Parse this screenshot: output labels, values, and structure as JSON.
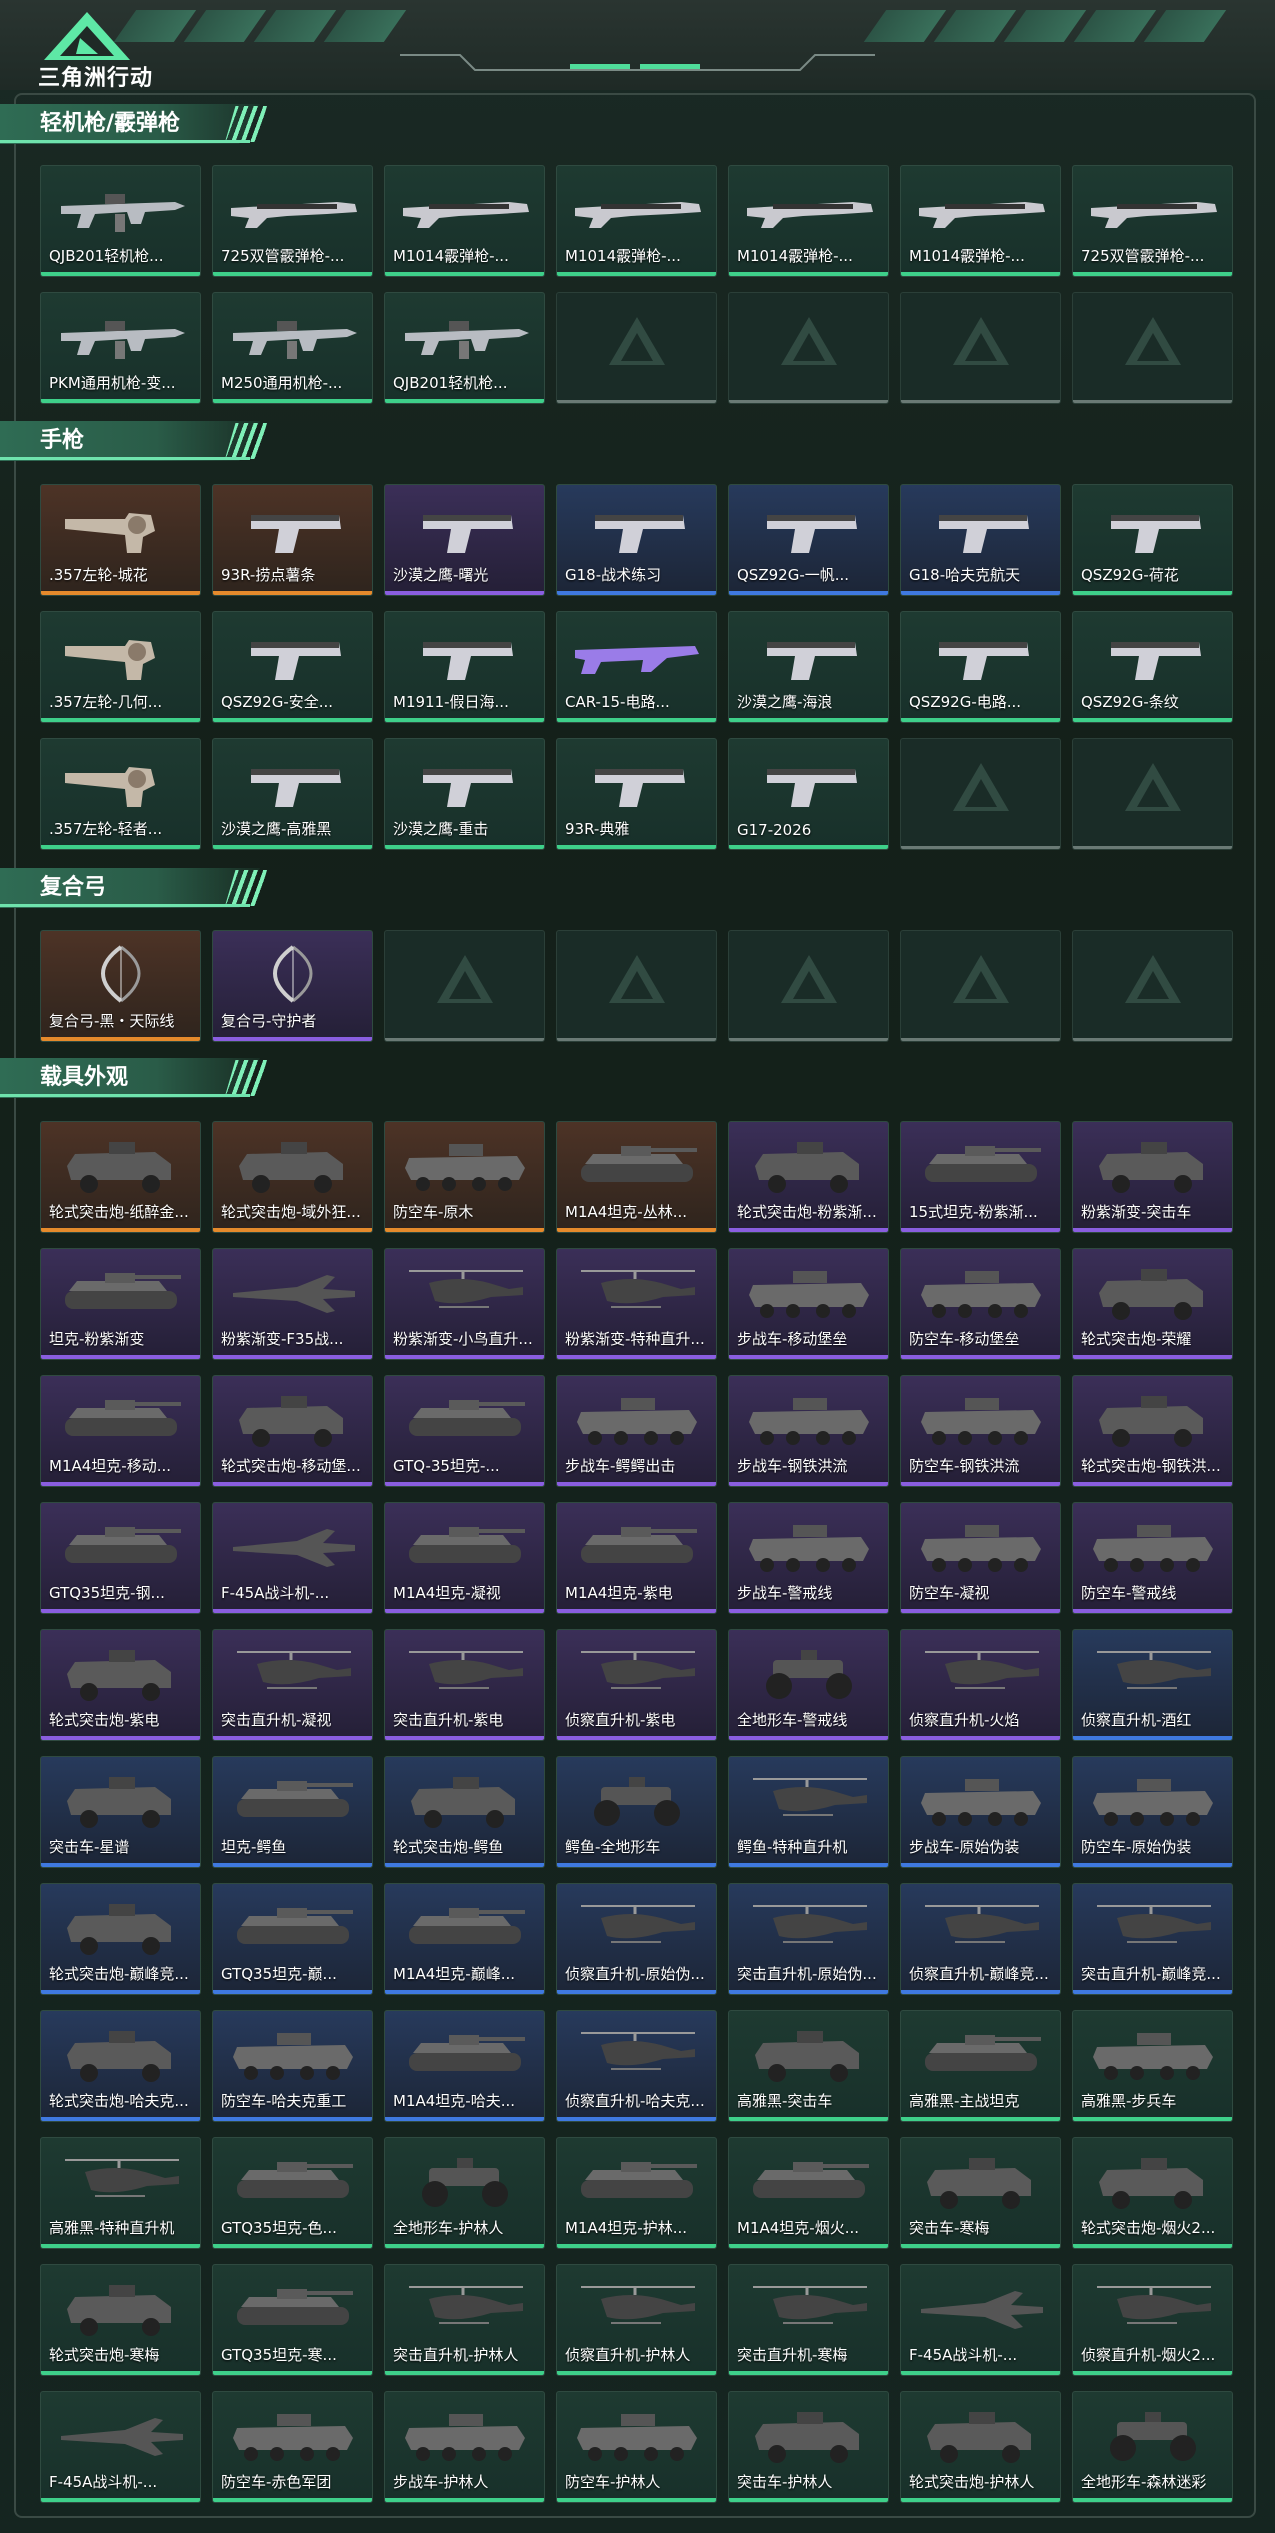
{
  "header": {
    "logo_text": "三角洲行动"
  },
  "sections": [
    {
      "title": "轻机枪/霰弹枪",
      "items": [
        {
          "label": "QJB201轻机枪...",
          "rarity": "green",
          "icon": "machine-gun"
        },
        {
          "label": "725双管霰弹枪-...",
          "rarity": "green",
          "icon": "shotgun"
        },
        {
          "label": "M1014霰弹枪-...",
          "rarity": "green",
          "icon": "shotgun"
        },
        {
          "label": "M1014霰弹枪-...",
          "rarity": "green",
          "icon": "shotgun"
        },
        {
          "label": "M1014霰弹枪-...",
          "rarity": "green",
          "icon": "shotgun"
        },
        {
          "label": "M1014霰弹枪-...",
          "rarity": "green",
          "icon": "shotgun"
        },
        {
          "label": "725双管霰弹枪-...",
          "rarity": "green",
          "icon": "shotgun"
        },
        {
          "label": "PKM通用机枪-变...",
          "rarity": "green",
          "icon": "machine-gun"
        },
        {
          "label": "M250通用机枪-...",
          "rarity": "green",
          "icon": "machine-gun"
        },
        {
          "label": "QJB201轻机枪...",
          "rarity": "green",
          "icon": "machine-gun"
        },
        {
          "label": "",
          "rarity": "empty",
          "icon": "empty-slot"
        },
        {
          "label": "",
          "rarity": "empty",
          "icon": "empty-slot"
        },
        {
          "label": "",
          "rarity": "empty",
          "icon": "empty-slot"
        },
        {
          "label": "",
          "rarity": "empty",
          "icon": "empty-slot"
        }
      ]
    },
    {
      "title": "手枪",
      "items": [
        {
          "label": ".357左轮-城花",
          "rarity": "orange",
          "icon": "revolver"
        },
        {
          "label": "93R-捞点薯条",
          "rarity": "orange",
          "icon": "pistol"
        },
        {
          "label": "沙漠之鹰-曙光",
          "rarity": "purple",
          "icon": "pistol"
        },
        {
          "label": "G18-战术练习",
          "rarity": "blue",
          "icon": "pistol"
        },
        {
          "label": "QSZ92G-一帆...",
          "rarity": "blue",
          "icon": "pistol"
        },
        {
          "label": "G18-哈夫克航天",
          "rarity": "blue",
          "icon": "pistol"
        },
        {
          "label": "QSZ92G-荷花",
          "rarity": "green",
          "icon": "pistol"
        },
        {
          "label": ".357左轮-几何...",
          "rarity": "green",
          "icon": "revolver"
        },
        {
          "label": "QSZ92G-安全...",
          "rarity": "green",
          "icon": "pistol"
        },
        {
          "label": "M1911-假日海...",
          "rarity": "green",
          "icon": "pistol"
        },
        {
          "label": "CAR-15-电路...",
          "rarity": "green",
          "icon": "rifle"
        },
        {
          "label": "沙漠之鹰-海浪",
          "rarity": "green",
          "icon": "pistol"
        },
        {
          "label": "QSZ92G-电路...",
          "rarity": "green",
          "icon": "pistol"
        },
        {
          "label": "QSZ92G-条纹",
          "rarity": "green",
          "icon": "pistol"
        },
        {
          "label": ".357左轮-轻者...",
          "rarity": "green",
          "icon": "revolver"
        },
        {
          "label": "沙漠之鹰-高雅黑",
          "rarity": "green",
          "icon": "pistol"
        },
        {
          "label": "沙漠之鹰-重击",
          "rarity": "green",
          "icon": "pistol"
        },
        {
          "label": "93R-典雅",
          "rarity": "green",
          "icon": "pistol"
        },
        {
          "label": "G17-2026",
          "rarity": "green",
          "icon": "pistol"
        },
        {
          "label": "",
          "rarity": "empty",
          "icon": "empty-slot"
        },
        {
          "label": "",
          "rarity": "empty",
          "icon": "empty-slot"
        }
      ]
    },
    {
      "title": "复合弓",
      "items": [
        {
          "label": "复合弓-黑・天际线",
          "rarity": "orange",
          "icon": "bow"
        },
        {
          "label": "复合弓-守护者",
          "rarity": "purple",
          "icon": "bow"
        },
        {
          "label": "",
          "rarity": "empty",
          "icon": "empty-slot"
        },
        {
          "label": "",
          "rarity": "empty",
          "icon": "empty-slot"
        },
        {
          "label": "",
          "rarity": "empty",
          "icon": "empty-slot"
        },
        {
          "label": "",
          "rarity": "empty",
          "icon": "empty-slot"
        },
        {
          "label": "",
          "rarity": "empty",
          "icon": "empty-slot"
        }
      ]
    },
    {
      "title": "载具外观",
      "items": [
        {
          "label": "轮式突击炮-纸醉金...",
          "rarity": "orange",
          "icon": "armored-car"
        },
        {
          "label": "轮式突击炮-域外狂...",
          "rarity": "orange",
          "icon": "armored-car"
        },
        {
          "label": "防空车-原木",
          "rarity": "orange",
          "icon": "apc"
        },
        {
          "label": "M1A4坦克-丛林...",
          "rarity": "orange",
          "icon": "tank"
        },
        {
          "label": "轮式突击炮-粉紫渐...",
          "rarity": "purple",
          "icon": "armored-car"
        },
        {
          "label": "15式坦克-粉紫渐...",
          "rarity": "purple",
          "icon": "tank"
        },
        {
          "label": "粉紫渐变-突击车",
          "rarity": "purple",
          "icon": "armored-car"
        },
        {
          "label": "坦克-粉紫渐变",
          "rarity": "purple",
          "icon": "tank"
        },
        {
          "label": "粉紫渐变-F35战...",
          "rarity": "purple",
          "icon": "jet"
        },
        {
          "label": "粉紫渐变-小鸟直升...",
          "rarity": "purple",
          "icon": "helicopter"
        },
        {
          "label": "粉紫渐变-特种直升...",
          "rarity": "purple",
          "icon": "helicopter"
        },
        {
          "label": "步战车-移动堡垒",
          "rarity": "purple",
          "icon": "apc"
        },
        {
          "label": "防空车-移动堡垒",
          "rarity": "purple",
          "icon": "apc"
        },
        {
          "label": "轮式突击炮-荣耀",
          "rarity": "purple",
          "icon": "armored-car"
        },
        {
          "label": "M1A4坦克-移动...",
          "rarity": "purple",
          "icon": "tank"
        },
        {
          "label": "轮式突击炮-移动堡...",
          "rarity": "purple",
          "icon": "armored-car"
        },
        {
          "label": "GTQ-35坦克-...",
          "rarity": "purple",
          "icon": "tank"
        },
        {
          "label": "步战车-鳄鳄出击",
          "rarity": "purple",
          "icon": "apc"
        },
        {
          "label": "步战车-钢铁洪流",
          "rarity": "purple",
          "icon": "apc"
        },
        {
          "label": "防空车-钢铁洪流",
          "rarity": "purple",
          "icon": "apc"
        },
        {
          "label": "轮式突击炮-钢铁洪...",
          "rarity": "purple",
          "icon": "armored-car"
        },
        {
          "label": "GTQ35坦克-钢...",
          "rarity": "purple",
          "icon": "tank"
        },
        {
          "label": "F-45A战斗机-...",
          "rarity": "purple",
          "icon": "jet"
        },
        {
          "label": "M1A4坦克-凝视",
          "rarity": "purple",
          "icon": "tank"
        },
        {
          "label": "M1A4坦克-紫电",
          "rarity": "purple",
          "icon": "tank"
        },
        {
          "label": "步战车-警戒线",
          "rarity": "purple",
          "icon": "apc"
        },
        {
          "label": "防空车-凝视",
          "rarity": "purple",
          "icon": "apc"
        },
        {
          "label": "防空车-警戒线",
          "rarity": "purple",
          "icon": "apc"
        },
        {
          "label": "轮式突击炮-紫电",
          "rarity": "purple",
          "icon": "armored-car"
        },
        {
          "label": "突击直升机-凝视",
          "rarity": "purple",
          "icon": "helicopter"
        },
        {
          "label": "突击直升机-紫电",
          "rarity": "purple",
          "icon": "helicopter"
        },
        {
          "label": "侦察直升机-紫电",
          "rarity": "purple",
          "icon": "helicopter"
        },
        {
          "label": "全地形车-警戒线",
          "rarity": "purple",
          "icon": "atv"
        },
        {
          "label": "侦察直升机-火焰",
          "rarity": "purple",
          "icon": "helicopter"
        },
        {
          "label": "侦察直升机-酒红",
          "rarity": "blue",
          "icon": "helicopter"
        },
        {
          "label": "突击车-星谱",
          "rarity": "blue",
          "icon": "armored-car"
        },
        {
          "label": "坦克-鳄鱼",
          "rarity": "blue",
          "icon": "tank"
        },
        {
          "label": "轮式突击炮-鳄鱼",
          "rarity": "blue",
          "icon": "armored-car"
        },
        {
          "label": "鳄鱼-全地形车",
          "rarity": "blue",
          "icon": "atv"
        },
        {
          "label": "鳄鱼-特种直升机",
          "rarity": "blue",
          "icon": "helicopter"
        },
        {
          "label": "步战车-原始伪装",
          "rarity": "blue",
          "icon": "apc"
        },
        {
          "label": "防空车-原始伪装",
          "rarity": "blue",
          "icon": "apc"
        },
        {
          "label": "轮式突击炮-巅峰竞...",
          "rarity": "blue",
          "icon": "armored-car"
        },
        {
          "label": "GTQ35坦克-巅...",
          "rarity": "blue",
          "icon": "tank"
        },
        {
          "label": "M1A4坦克-巅峰...",
          "rarity": "blue",
          "icon": "tank"
        },
        {
          "label": "侦察直升机-原始伪...",
          "rarity": "blue",
          "icon": "helicopter"
        },
        {
          "label": "突击直升机-原始伪...",
          "rarity": "blue",
          "icon": "helicopter"
        },
        {
          "label": "侦察直升机-巅峰竞...",
          "rarity": "blue",
          "icon": "helicopter"
        },
        {
          "label": "突击直升机-巅峰竞...",
          "rarity": "blue",
          "icon": "helicopter"
        },
        {
          "label": "轮式突击炮-哈夫克...",
          "rarity": "blue",
          "icon": "armored-car"
        },
        {
          "label": "防空车-哈夫克重工",
          "rarity": "blue",
          "icon": "apc"
        },
        {
          "label": "M1A4坦克-哈夫...",
          "rarity": "blue",
          "icon": "tank"
        },
        {
          "label": "侦察直升机-哈夫克...",
          "rarity": "blue",
          "icon": "helicopter"
        },
        {
          "label": "高雅黑-突击车",
          "rarity": "green",
          "icon": "armored-car"
        },
        {
          "label": "高雅黑-主战坦克",
          "rarity": "green",
          "icon": "tank"
        },
        {
          "label": "高雅黑-步兵车",
          "rarity": "green",
          "icon": "apc"
        },
        {
          "label": "高雅黑-特种直升机",
          "rarity": "green",
          "icon": "helicopter"
        },
        {
          "label": "GTQ35坦克-色...",
          "rarity": "green",
          "icon": "tank"
        },
        {
          "label": "全地形车-护林人",
          "rarity": "green",
          "icon": "atv"
        },
        {
          "label": "M1A4坦克-护林...",
          "rarity": "green",
          "icon": "tank"
        },
        {
          "label": "M1A4坦克-烟火...",
          "rarity": "green",
          "icon": "tank"
        },
        {
          "label": "突击车-寒梅",
          "rarity": "green",
          "icon": "armored-car"
        },
        {
          "label": "轮式突击炮-烟火2...",
          "rarity": "green",
          "icon": "armored-car"
        },
        {
          "label": "轮式突击炮-寒梅",
          "rarity": "green",
          "icon": "armored-car"
        },
        {
          "label": "GTQ35坦克-寒...",
          "rarity": "green",
          "icon": "tank"
        },
        {
          "label": "突击直升机-护林人",
          "rarity": "green",
          "icon": "helicopter"
        },
        {
          "label": "侦察直升机-护林人",
          "rarity": "green",
          "icon": "helicopter"
        },
        {
          "label": "突击直升机-寒梅",
          "rarity": "green",
          "icon": "helicopter"
        },
        {
          "label": "F-45A战斗机-...",
          "rarity": "green",
          "icon": "jet"
        },
        {
          "label": "侦察直升机-烟火2...",
          "rarity": "green",
          "icon": "helicopter"
        },
        {
          "label": "F-45A战斗机-...",
          "rarity": "green",
          "icon": "jet"
        },
        {
          "label": "防空车-赤色军团",
          "rarity": "green",
          "icon": "apc"
        },
        {
          "label": "步战车-护林人",
          "rarity": "green",
          "icon": "apc"
        },
        {
          "label": "防空车-护林人",
          "rarity": "green",
          "icon": "apc"
        },
        {
          "label": "突击车-护林人",
          "rarity": "green",
          "icon": "armored-car"
        },
        {
          "label": "轮式突击炮-护林人",
          "rarity": "green",
          "icon": "armored-car"
        },
        {
          "label": "全地形车-森林迷彩",
          "rarity": "green",
          "icon": "atv"
        }
      ]
    }
  ]
}
